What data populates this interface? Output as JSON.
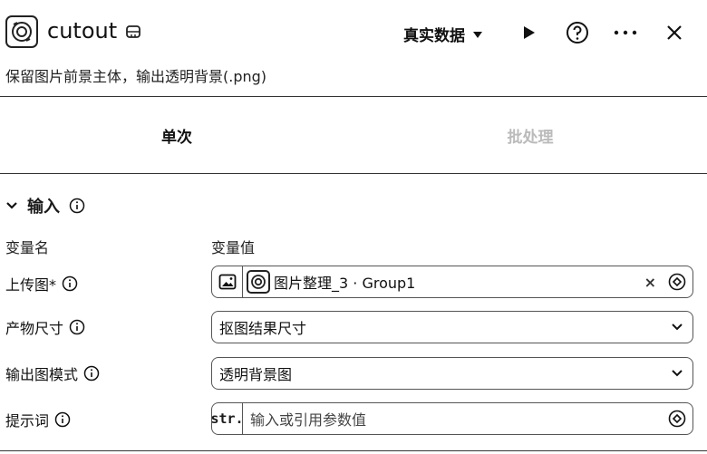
{
  "header": {
    "title": "cutout",
    "data_mode": "真实数据",
    "subtitle": "保留图片前景主体，输出透明背景(.png)"
  },
  "tabs": [
    {
      "label": "单次"
    },
    {
      "label": "批处理"
    }
  ],
  "section": {
    "label": "输入"
  },
  "columns": {
    "name": "变量名",
    "value": "变量值"
  },
  "rows": [
    {
      "label": "上传图*",
      "value": "图片整理_3 · Group1"
    },
    {
      "label": "产物尺寸",
      "value": "抠图结果尺寸"
    },
    {
      "label": "输出图模式",
      "value": "透明背景图"
    },
    {
      "label": "提示词",
      "prefix": "str.",
      "placeholder": "输入或引用参数值"
    }
  ]
}
